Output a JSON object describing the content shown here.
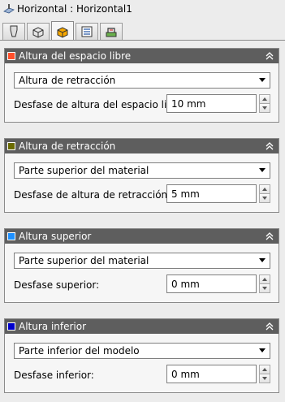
{
  "window": {
    "title": "Horizontal : Horizontal1",
    "icon": "operation-icon"
  },
  "tabs": [
    {
      "icon": "tool-icon",
      "active": false
    },
    {
      "icon": "geometry-icon",
      "active": false
    },
    {
      "icon": "heights-icon",
      "active": true
    },
    {
      "icon": "passes-icon",
      "active": false
    },
    {
      "icon": "linking-icon",
      "active": false
    }
  ],
  "colors": {
    "clearance": "#ff4f2a",
    "retract": "#6b6b00",
    "top": "#1e90ff",
    "bottom": "#0000cc",
    "header_bg": "#5e5e5e"
  },
  "panels": [
    {
      "title": "Altura del espacio libre",
      "select_value": "Altura de retracción",
      "field_label": "Desfase de altura del espacio libre:",
      "field_value": "10 mm"
    },
    {
      "title": "Altura de retracción",
      "select_value": "Parte superior del material",
      "field_label": "Desfase de altura de retracción:",
      "field_value": "5 mm"
    },
    {
      "title": "Altura superior",
      "select_value": "Parte superior del material",
      "field_label": "Desfase superior:",
      "field_value": "0 mm"
    },
    {
      "title": "Altura inferior",
      "select_value": "Parte inferior del modelo",
      "field_label": "Desfase inferior:",
      "field_value": "0 mm"
    }
  ]
}
